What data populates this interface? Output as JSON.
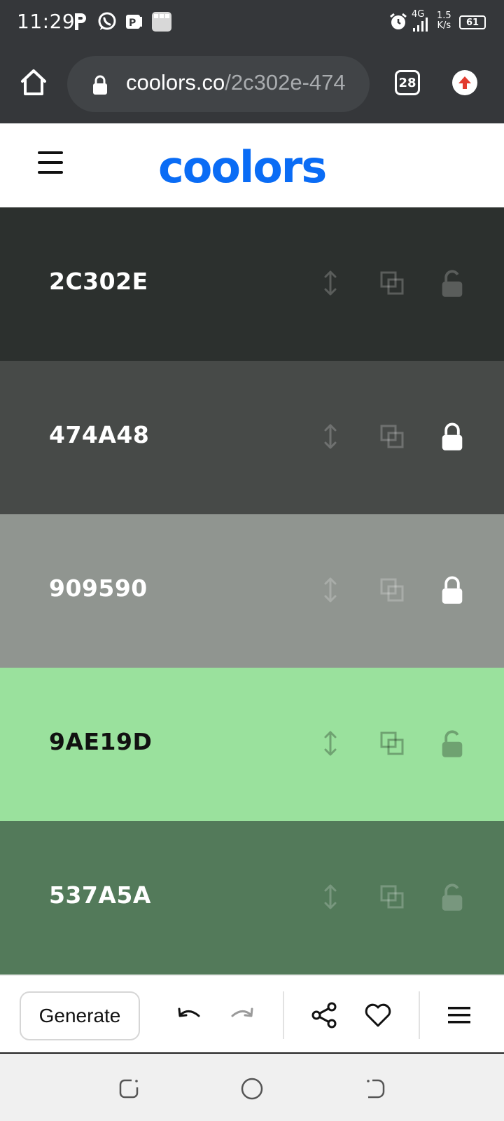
{
  "status_bar": {
    "time": "11:29",
    "network_type": "4G",
    "net_speed_value": "1.5",
    "net_speed_unit": "K/s",
    "battery": "61"
  },
  "browser": {
    "url_domain": "coolors.co",
    "url_path": "/2c302e-474",
    "tab_count": "28"
  },
  "app": {
    "logo": "coolors"
  },
  "palette": {
    "colors": [
      {
        "hex": "2C302E",
        "bg": "#2c302e",
        "text_color": "#ffffff",
        "locked": false
      },
      {
        "hex": "474A48",
        "bg": "#474a48",
        "text_color": "#ffffff",
        "locked": true
      },
      {
        "hex": "909590",
        "bg": "#909590",
        "text_color": "#ffffff",
        "locked": true
      },
      {
        "hex": "9AE19D",
        "bg": "#9ae19d",
        "text_color": "#111111",
        "locked": false
      },
      {
        "hex": "537A5A",
        "bg": "#537a5a",
        "text_color": "#ffffff",
        "locked": false
      }
    ]
  },
  "toolbar": {
    "generate_label": "Generate"
  },
  "icons": {
    "status": [
      "p-app-icon",
      "whatsapp-icon",
      "document-icon",
      "gallery-icon",
      "alarm-icon",
      "signal-icon",
      "battery-icon"
    ],
    "browser": [
      "home-icon",
      "lock-icon",
      "tabs-icon",
      "update-icon"
    ],
    "swatch_tools": [
      "drag-vertical-icon",
      "copy-icon",
      "lock-icon"
    ],
    "toolbar": [
      "undo-icon",
      "redo-icon",
      "share-icon",
      "heart-icon",
      "menu-icon"
    ],
    "nav": [
      "recents-icon",
      "home-circle-icon",
      "back-icon"
    ]
  },
  "colors": {
    "chrome_bg": "#35373a",
    "url_pill_bg": "#414447",
    "brand_blue": "#0a6cf5",
    "nav_bg": "#f0f0f0"
  }
}
